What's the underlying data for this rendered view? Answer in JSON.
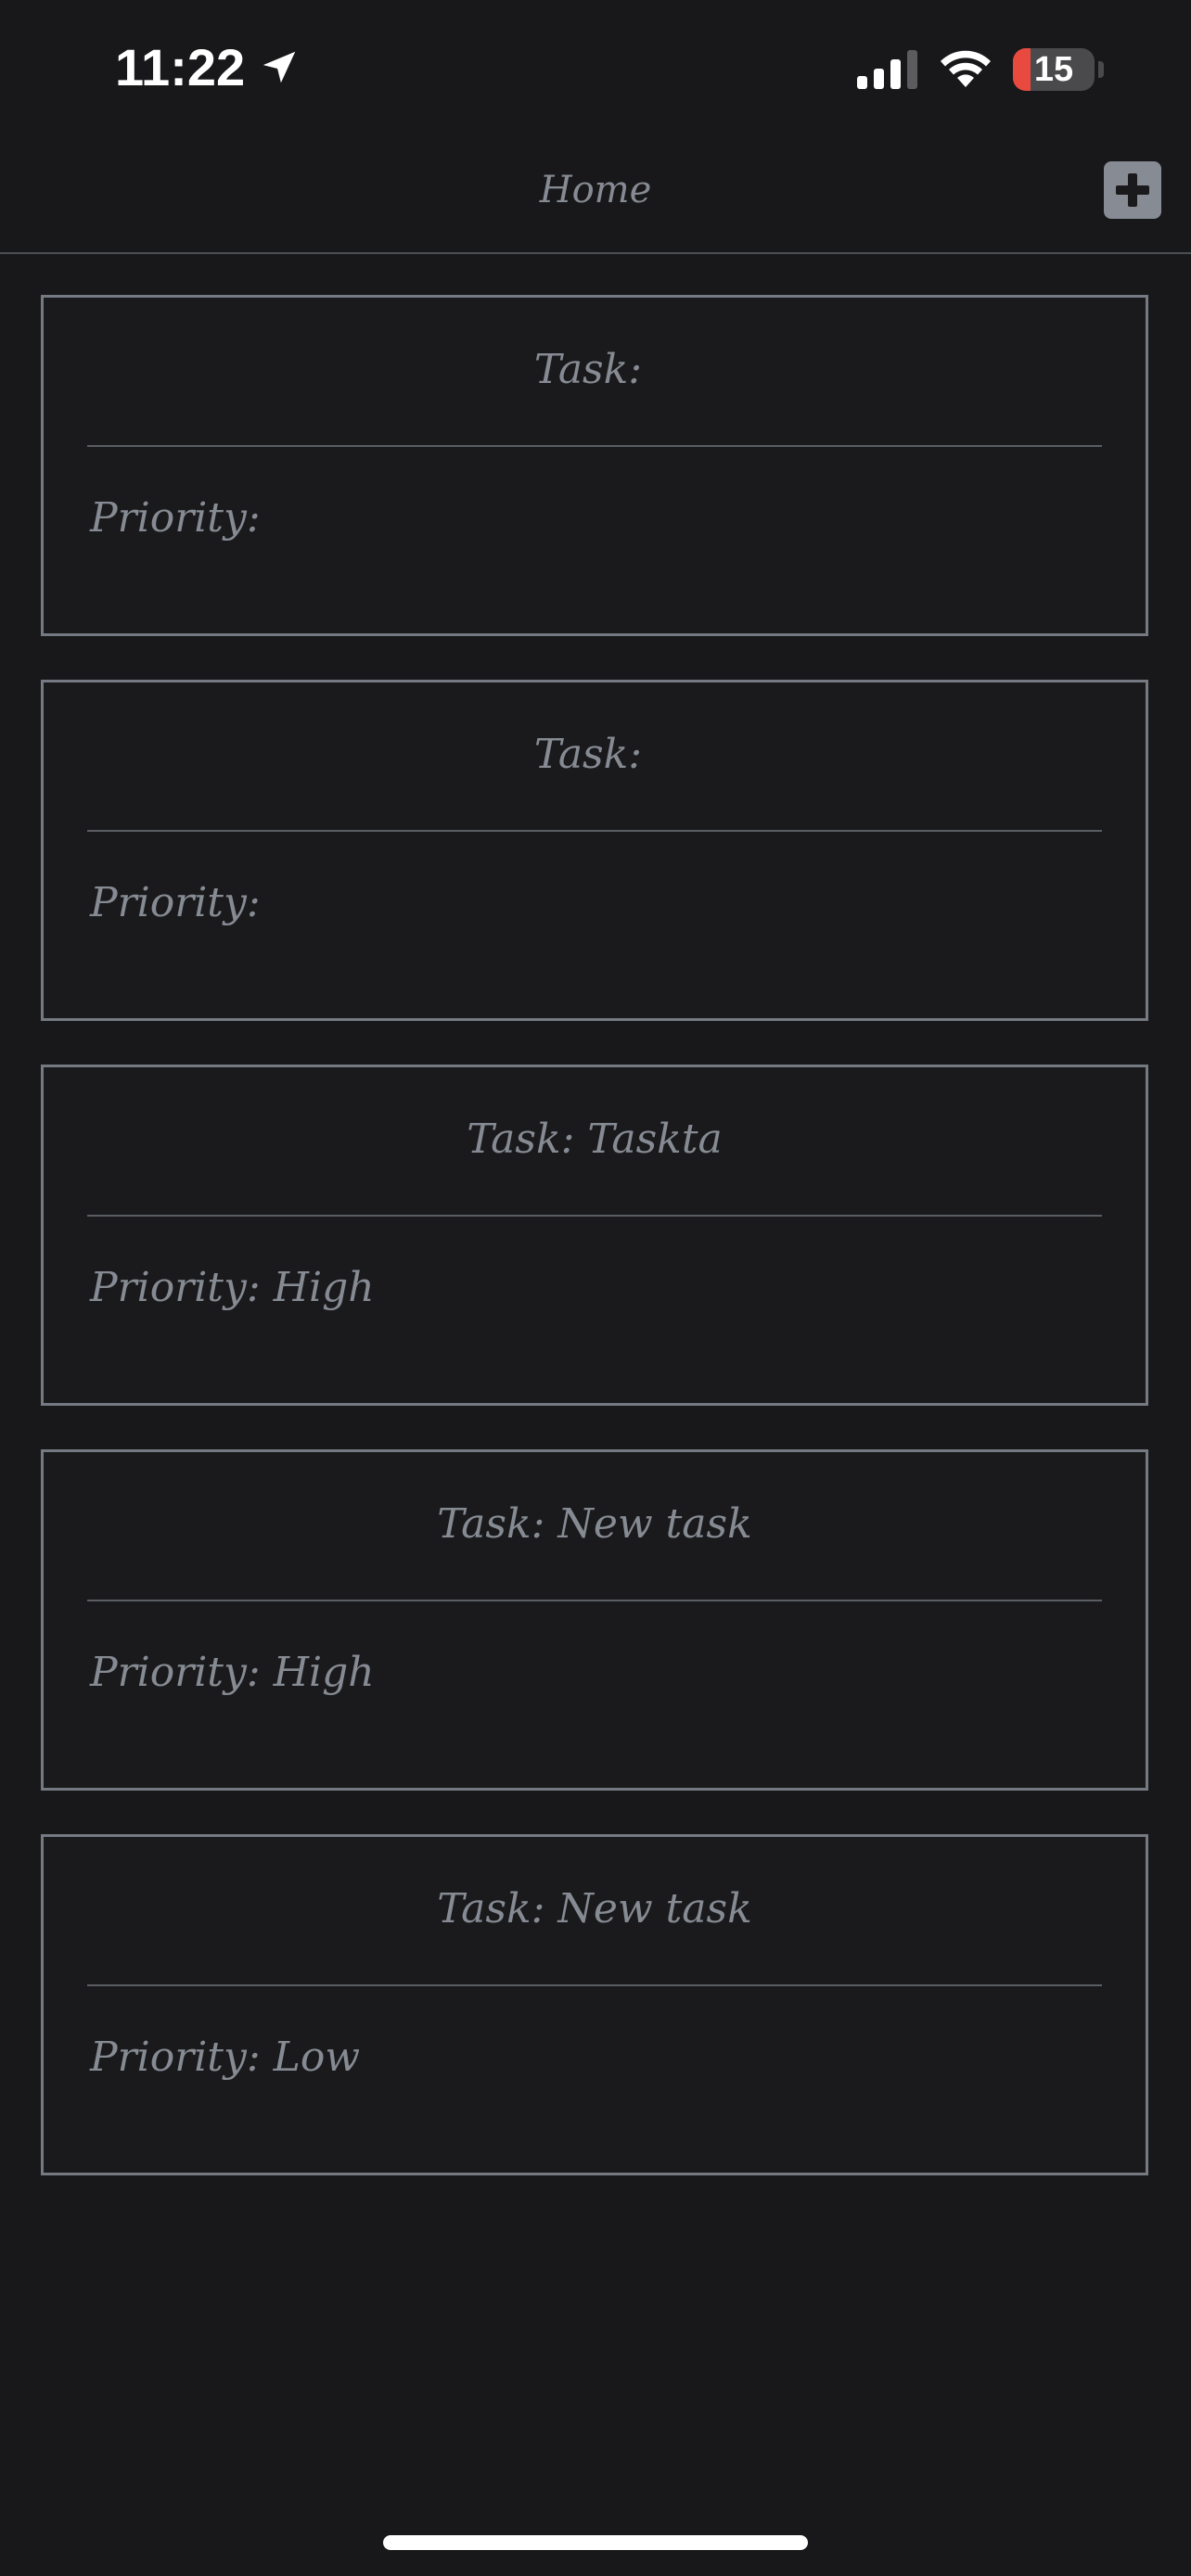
{
  "status_bar": {
    "time": "11:22",
    "battery_level": "15",
    "battery_fraction": 0.15,
    "icons": [
      "location-arrow-icon",
      "cellular-signal-icon",
      "wifi-icon",
      "battery-icon"
    ],
    "colors": {
      "text": "#ffffff",
      "battery_low": "#e84a3f"
    }
  },
  "nav": {
    "title": "Home",
    "add_button_icon": "plus-icon"
  },
  "tasks": [
    {
      "task_label": "Task: ",
      "priority_label": "Priority: "
    },
    {
      "task_label": "Task: ",
      "priority_label": "Priority: "
    },
    {
      "task_label": "Task: Taskta",
      "priority_label": "Priority: High"
    },
    {
      "task_label": "Task: New task",
      "priority_label": "Priority: High"
    },
    {
      "task_label": "Task: New task",
      "priority_label": "Priority: Low"
    }
  ],
  "theme": {
    "background": "#18181a",
    "text": "#868b93",
    "card_border": "#757a82",
    "accent_button": "#868b94"
  }
}
